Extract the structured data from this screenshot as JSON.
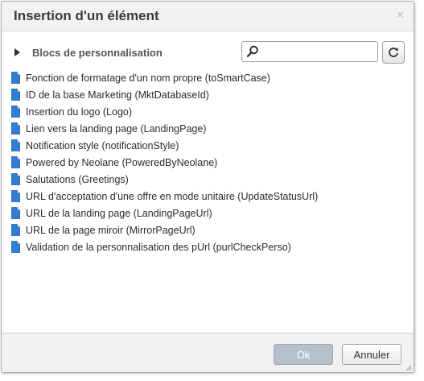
{
  "dialog": {
    "title": "Insertion d'un élément",
    "close_symbol": "×"
  },
  "section": {
    "label": "Blocs de personnalisation",
    "expand_icon": "triangle-right-icon"
  },
  "search": {
    "value": "",
    "placeholder": "",
    "icon": "search-icon"
  },
  "refresh": {
    "icon": "refresh-icon"
  },
  "items": [
    {
      "label": "Fonction de formatage d'un nom propre (toSmartCase)",
      "icon": "document-icon"
    },
    {
      "label": "ID de la base Marketing (MktDatabaseId)",
      "icon": "document-icon"
    },
    {
      "label": "Insertion du logo (Logo)",
      "icon": "document-icon"
    },
    {
      "label": "Lien vers la landing page (LandingPage)",
      "icon": "document-icon"
    },
    {
      "label": "Notification style (notificationStyle)",
      "icon": "document-icon"
    },
    {
      "label": "Powered by Neolane (PoweredByNeolane)",
      "icon": "document-icon"
    },
    {
      "label": "Salutations (Greetings)",
      "icon": "document-icon"
    },
    {
      "label": "URL d'acceptation d'une offre en mode unitaire (UpdateStatusUrl)",
      "icon": "document-icon"
    },
    {
      "label": "URL de la landing page (LandingPageUrl)",
      "icon": "document-icon"
    },
    {
      "label": "URL de la page miroir (MirrorPageUrl)",
      "icon": "document-icon"
    },
    {
      "label": "Validation de la personnalisation des pUrl (purlCheckPerso)",
      "icon": "document-icon"
    }
  ],
  "footer": {
    "ok_label": "Ok",
    "cancel_label": "Annuler"
  },
  "colors": {
    "icon_blue": "#2f7fd4",
    "ok_button": "#b5c0cc",
    "titlebar": "#f2f2f2"
  }
}
